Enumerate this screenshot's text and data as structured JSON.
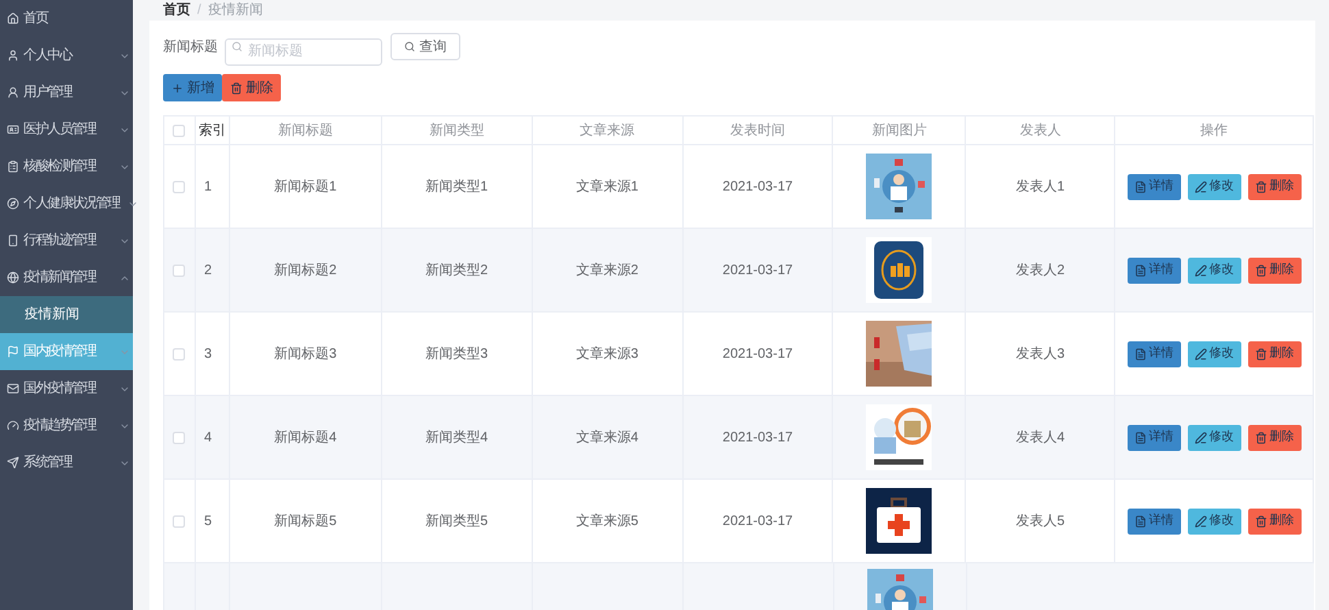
{
  "sidebar": {
    "items": [
      {
        "label": "首页",
        "hovered": false
      },
      {
        "label": "个人中心",
        "expanded": false,
        "hovered": false
      },
      {
        "label": "用户管理",
        "expanded": false,
        "hovered": false
      },
      {
        "label": "医护人员管理",
        "expanded": false,
        "hovered": false
      },
      {
        "label": "核酸检测管理",
        "expanded": false,
        "hovered": false
      },
      {
        "label": "个人健康状况管理",
        "expanded": false,
        "hovered": false
      },
      {
        "label": "行程轨迹管理",
        "expanded": false,
        "hovered": false
      },
      {
        "label": "疫情新闻管理",
        "expanded": true,
        "hovered": false,
        "children": [
          {
            "label": "疫情新闻",
            "selected": true
          }
        ]
      },
      {
        "label": "国内疫情管理",
        "expanded": false,
        "hovered": true
      },
      {
        "label": "国外疫情管理",
        "expanded": false,
        "hovered": false
      },
      {
        "label": "疫情趋势管理",
        "expanded": false,
        "hovered": false
      },
      {
        "label": "系统管理",
        "expanded": false,
        "hovered": false
      }
    ]
  },
  "breadcrumb": {
    "items": [
      "首页",
      "疫情新闻"
    ],
    "separator": "/"
  },
  "search": {
    "label": "新闻标题",
    "placeholder": "新闻标题",
    "button": "查询"
  },
  "actions": [
    {
      "label": "新增",
      "kind": "add"
    },
    {
      "label": "删除",
      "kind": "delete"
    }
  ],
  "table": {
    "header_checked": false,
    "columns": [
      "索引",
      "新闻标题",
      "新闻类型",
      "文章来源",
      "发表时间",
      "新闻图片",
      "发表人",
      "操作"
    ],
    "rows": [
      {
        "kind": "full",
        "checked": false,
        "index": "1",
        "title": "新闻标题1",
        "type": "新闻类型1",
        "source": "文章来源1",
        "time": "2021-03-17",
        "author": "发表人1",
        "buttons": [
          {
            "label": "详情",
            "kind": "detail"
          },
          {
            "label": "修改",
            "kind": "edit"
          },
          {
            "label": "删除",
            "kind": "delete"
          }
        ]
      },
      {
        "kind": "full",
        "checked": false,
        "index": "2",
        "title": "新闻标题2",
        "type": "新闻类型2",
        "source": "文章来源2",
        "time": "2021-03-17",
        "author": "发表人2",
        "buttons": [
          {
            "label": "详情",
            "kind": "detail"
          },
          {
            "label": "修改",
            "kind": "edit"
          },
          {
            "label": "删除",
            "kind": "delete"
          }
        ]
      },
      {
        "kind": "full",
        "checked": false,
        "index": "3",
        "title": "新闻标题3",
        "type": "新闻类型3",
        "source": "文章来源3",
        "time": "2021-03-17",
        "author": "发表人3",
        "buttons": [
          {
            "label": "详情",
            "kind": "detail"
          },
          {
            "label": "修改",
            "kind": "edit"
          },
          {
            "label": "删除",
            "kind": "delete"
          }
        ]
      },
      {
        "kind": "full",
        "checked": false,
        "index": "4",
        "title": "新闻标题4",
        "type": "新闻类型4",
        "source": "文章来源4",
        "time": "2021-03-17",
        "author": "发表人4",
        "buttons": [
          {
            "label": "详情",
            "kind": "detail"
          },
          {
            "label": "修改",
            "kind": "edit"
          },
          {
            "label": "删除",
            "kind": "delete"
          }
        ]
      },
      {
        "kind": "full",
        "checked": false,
        "index": "5",
        "title": "新闻标题5",
        "type": "新闻类型5",
        "source": "文章来源5",
        "time": "2021-03-17",
        "author": "发表人5",
        "buttons": [
          {
            "label": "详情",
            "kind": "detail"
          },
          {
            "label": "修改",
            "kind": "edit"
          },
          {
            "label": "删除",
            "kind": "delete"
          }
        ]
      },
      {
        "kind": "partial"
      }
    ]
  }
}
